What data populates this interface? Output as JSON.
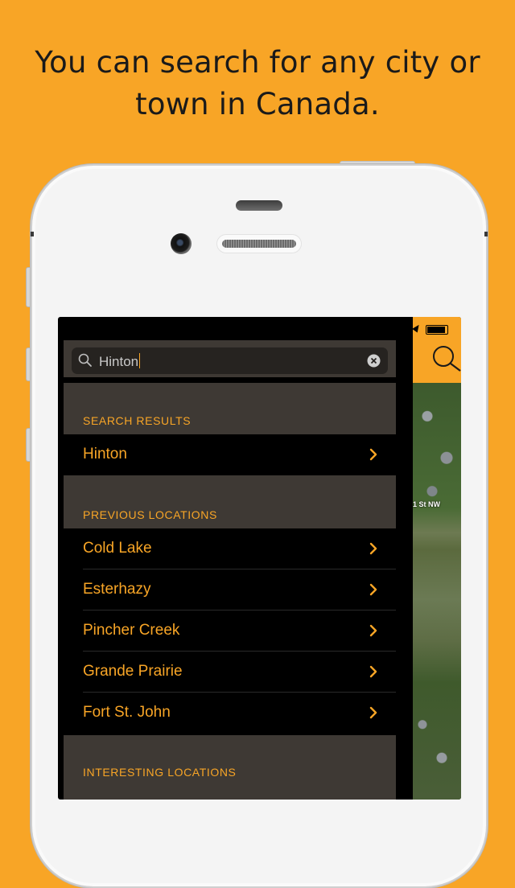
{
  "headline": "You can search for any city or town in Canada.",
  "search": {
    "value": "Hinton",
    "placeholder": ""
  },
  "sections": {
    "results_label": "SEARCH RESULTS",
    "previous_label": "PREVIOUS LOCATIONS",
    "interesting_label": "INTERESTING LOCATIONS"
  },
  "search_results": [
    "Hinton"
  ],
  "previous_locations": [
    "Cold Lake",
    "Esterhazy",
    "Pincher Creek",
    "Grande Prairie",
    "Fort St. John"
  ],
  "map": {
    "street_label": "1 St NW"
  },
  "colors": {
    "accent": "#f8a526",
    "section_bg": "#3e3934",
    "row_bg": "#000000"
  },
  "icons": [
    "search-icon",
    "clear-icon",
    "chevron-right-icon",
    "location-arrow-icon",
    "battery-icon"
  ]
}
